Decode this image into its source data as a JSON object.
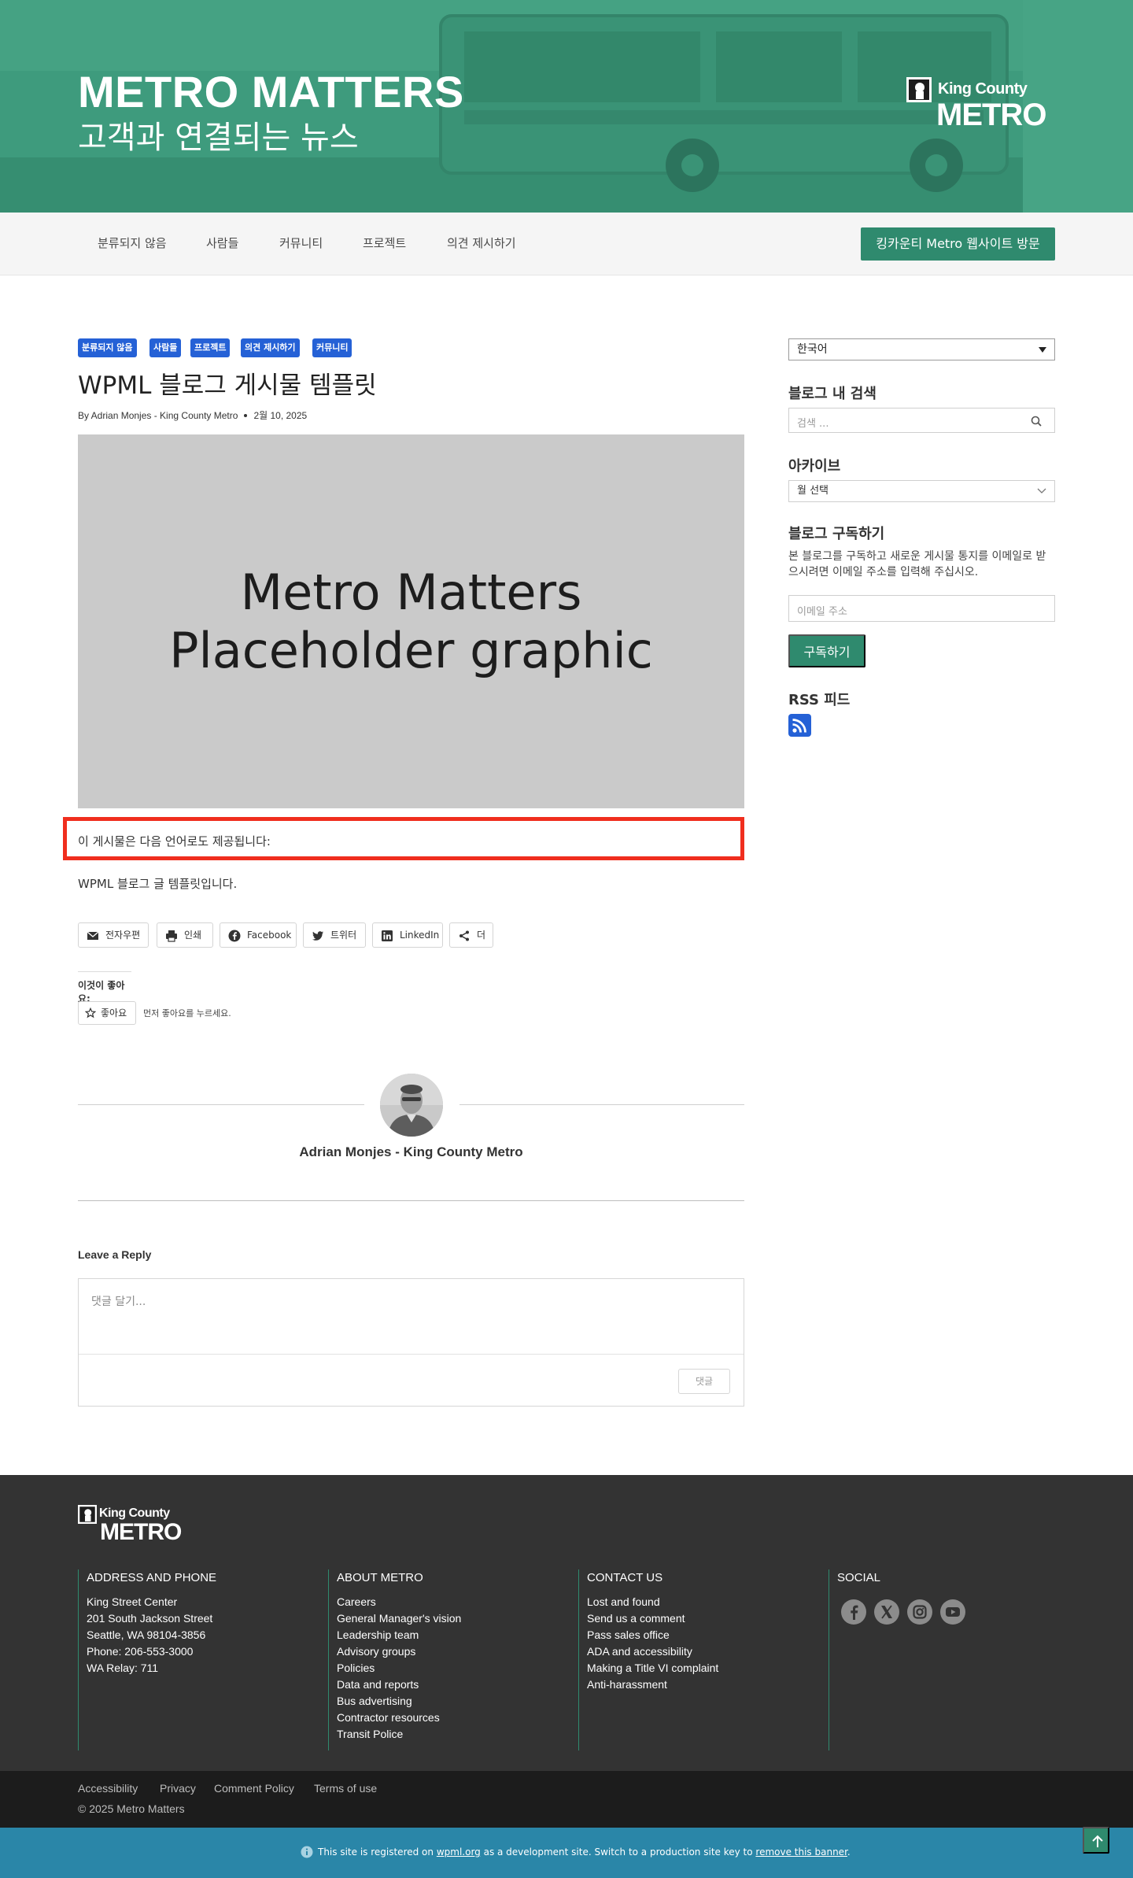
{
  "colors": {
    "brand_green": "#2f8a6e",
    "hero_green": "#3d9a7c",
    "category_blue": "#2561d6",
    "highlight_red": "#f02e1e",
    "footer_bg": "#333333",
    "subfooter_bg": "#1c1c1c",
    "wpml_banner_bg": "#2a86a8"
  },
  "header": {
    "title": "METRO MATTERS",
    "subtitle": "고객과 연결되는 뉴스",
    "logo": {
      "line1": "King County",
      "line2": "METRO",
      "icon": "king-county-seal-icon"
    }
  },
  "nav": {
    "items": [
      "분류되지 않음",
      "사람들",
      "커뮤니티",
      "프로젝트",
      "의견 제시하기"
    ],
    "cta": "킹카운티 Metro 웹사이트 방문"
  },
  "post": {
    "categories": [
      "분류되지 않음",
      "사람들",
      "프로젝트",
      "의견 제시하기",
      "커뮤니티"
    ],
    "title": "WPML 블로그 게시물 템플릿",
    "author": "By Adrian Monjes - King County Metro",
    "date": "2월 10, 2025",
    "featured_line1": "Metro Matters",
    "featured_line2": "Placeholder graphic",
    "lang_notice": "이 게시물은 다음 언어로도 제공됩니다:",
    "body": "WPML 블로그 글 템플릿입니다."
  },
  "share": {
    "buttons": [
      {
        "label": "전자우편",
        "icon": "email-icon"
      },
      {
        "label": "인쇄",
        "icon": "print-icon"
      },
      {
        "label": "Facebook",
        "icon": "facebook-icon"
      },
      {
        "label": "트위터",
        "icon": "twitter-icon"
      },
      {
        "label": "LinkedIn",
        "icon": "linkedin-icon"
      },
      {
        "label": "더",
        "icon": "share-icon"
      }
    ]
  },
  "like": {
    "label": "이것이 좋아요:",
    "button": "좋아요",
    "hint": "먼저 좋아요를 누르세요."
  },
  "author_box": {
    "name": "Adrian Monjes - King County Metro"
  },
  "reply": {
    "title": "Leave a Reply",
    "placeholder": "댓글 달기...",
    "submit": "댓글"
  },
  "sidebar": {
    "language": "한국어",
    "search_heading": "블로그 내 검색",
    "search_placeholder": "검색 ...",
    "archive_heading": "아카이브",
    "archive_select": "월 선택",
    "subscribe_heading": "블로그 구독하기",
    "subscribe_desc": "본 블로그를 구독하고 새로운 게시물 통지를 이메일로 받으시려면 이메일 주소를 입력해 주십시오.",
    "email_placeholder": "이메일 주소",
    "subscribe_button": "구독하기",
    "rss_heading": "RSS 피드"
  },
  "footer": {
    "logo": {
      "line1": "King County",
      "line2": "METRO"
    },
    "columns": [
      {
        "heading": "ADDRESS AND PHONE",
        "items": [
          "King Street Center",
          "201 South Jackson Street",
          "Seattle, WA 98104-3856",
          "Phone: 206-553-3000",
          "WA Relay: 711"
        ]
      },
      {
        "heading": "ABOUT METRO",
        "items": [
          "Careers",
          "General Manager's vision",
          "Leadership team",
          "Advisory groups",
          "Policies",
          "Data and reports",
          "Bus advertising",
          "Contractor resources",
          "Transit Police"
        ]
      },
      {
        "heading": "CONTACT US",
        "items": [
          "Lost and found",
          "Send us a comment",
          "Pass sales office",
          "ADA and accessibility",
          "Making a Title VI complaint",
          "Anti-harassment"
        ]
      },
      {
        "heading": "SOCIAL",
        "items": []
      }
    ],
    "social": [
      "facebook-icon",
      "x-icon",
      "instagram-icon",
      "youtube-icon"
    ],
    "sub_links": [
      "Accessibility",
      "Privacy",
      "Comment Policy",
      "Terms of use"
    ],
    "copyright": "© 2025 Metro Matters"
  },
  "wpml_banner": {
    "text_before": "This site is registered on ",
    "link1": "wpml.org",
    "text_middle": " as a development site. Switch to a production site key to ",
    "link2": "remove this banner",
    "text_after": "."
  }
}
